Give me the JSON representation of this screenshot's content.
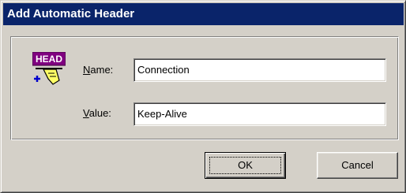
{
  "window": {
    "title": "Add Automatic Header"
  },
  "icon": {
    "name": "header-icon",
    "badge_text": "HEAD",
    "colors": {
      "badge": "#800080",
      "hand": "#ffff66"
    }
  },
  "form": {
    "name_label_accel": "N",
    "name_label_rest": "ame:",
    "name_value": "Connection",
    "value_label_accel": "V",
    "value_label_rest": "alue:",
    "value_value": "Keep-Alive"
  },
  "buttons": {
    "ok_label": "OK",
    "cancel_label": "Cancel"
  },
  "colors": {
    "titlebar": "#0a246a",
    "dialog_face": "#d4d0c8"
  }
}
